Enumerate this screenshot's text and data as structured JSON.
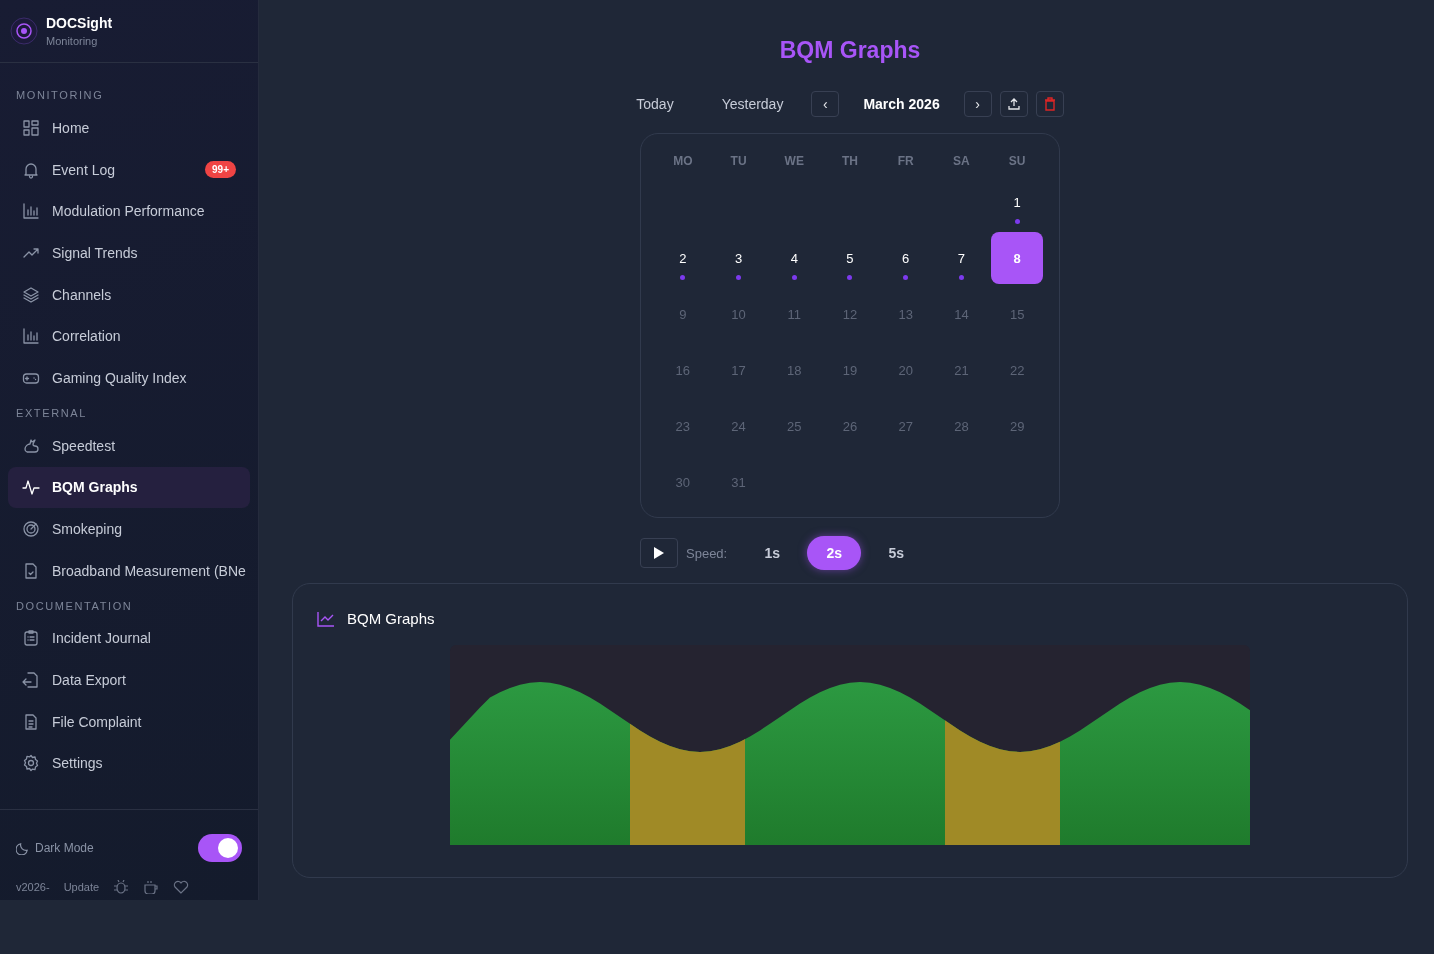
{
  "brand": {
    "name": "DOCSight",
    "subtitle": "Monitoring"
  },
  "sidebar": {
    "sections": [
      {
        "title": "MONITORING",
        "items": [
          {
            "label": "Home",
            "selected": false
          },
          {
            "label": "Event Log",
            "selected": false,
            "badge": "99+"
          },
          {
            "label": "Modulation Performance",
            "selected": false
          },
          {
            "label": "Signal Trends",
            "selected": false
          },
          {
            "label": "Channels",
            "selected": false
          },
          {
            "label": "Correlation",
            "selected": false
          },
          {
            "label": "Gaming Quality Index",
            "selected": false
          }
        ]
      },
      {
        "title": "EXTERNAL",
        "items": [
          {
            "label": "Speedtest",
            "selected": false
          },
          {
            "label": "BQM Graphs",
            "selected": true
          },
          {
            "label": "Smokeping",
            "selected": false
          },
          {
            "label": "Broadband Measurement (BNe",
            "selected": false
          }
        ]
      },
      {
        "title": "DOCUMENTATION",
        "items": [
          {
            "label": "Incident Journal",
            "selected": false
          },
          {
            "label": "Data Export",
            "selected": false
          },
          {
            "label": "File Complaint",
            "selected": false
          },
          {
            "label": "Settings",
            "selected": false
          }
        ]
      }
    ],
    "dark_mode": {
      "label": "Dark Mode",
      "on": true
    },
    "footer": {
      "version": "v2026-",
      "update": "Update"
    }
  },
  "page": {
    "title": "BQM Graphs",
    "quick_dates": [
      {
        "label": "Today"
      },
      {
        "label": "Yesterday"
      }
    ],
    "prev": "‹",
    "month": "March 2026",
    "next": "›",
    "weekdays": [
      "MO",
      "TU",
      "WE",
      "TH",
      "FR",
      "SA",
      "SU"
    ],
    "weeks": [
      [
        {
          "day": "1",
          "has_data": true,
          "selected": false
        }
      ],
      [
        {
          "day": "2",
          "has_data": true,
          "selected": false
        },
        {
          "day": "3",
          "has_data": true,
          "selected": false
        },
        {
          "day": "4",
          "has_data": true,
          "selected": false
        },
        {
          "day": "5",
          "has_data": true,
          "selected": false
        },
        {
          "day": "6",
          "has_data": true,
          "selected": false
        },
        {
          "day": "7",
          "has_data": true,
          "selected": false
        },
        {
          "day": "8",
          "has_data": true,
          "selected": true
        }
      ],
      [
        {
          "day": "9",
          "has_data": false,
          "selected": false
        },
        {
          "day": "10",
          "has_data": false,
          "selected": false
        },
        {
          "day": "11",
          "has_data": false,
          "selected": false
        },
        {
          "day": "12",
          "has_data": false,
          "selected": false
        },
        {
          "day": "13",
          "has_data": false,
          "selected": false
        },
        {
          "day": "14",
          "has_data": false,
          "selected": false
        },
        {
          "day": "15",
          "has_data": false,
          "selected": false
        }
      ],
      [
        {
          "day": "16",
          "has_data": false,
          "selected": false
        },
        {
          "day": "17",
          "has_data": false,
          "selected": false
        },
        {
          "day": "18",
          "has_data": false,
          "selected": false
        },
        {
          "day": "19",
          "has_data": false,
          "selected": false
        },
        {
          "day": "20",
          "has_data": false,
          "selected": false
        },
        {
          "day": "21",
          "has_data": false,
          "selected": false
        },
        {
          "day": "22",
          "has_data": false,
          "selected": false
        }
      ],
      [
        {
          "day": "23",
          "has_data": false,
          "selected": false
        },
        {
          "day": "24",
          "has_data": false,
          "selected": false
        },
        {
          "day": "25",
          "has_data": false,
          "selected": false
        },
        {
          "day": "26",
          "has_data": false,
          "selected": false
        },
        {
          "day": "27",
          "has_data": false,
          "selected": false
        },
        {
          "day": "28",
          "has_data": false,
          "selected": false
        },
        {
          "day": "29",
          "has_data": false,
          "selected": false
        }
      ],
      [
        {
          "day": "30",
          "has_data": false,
          "selected": false
        },
        {
          "day": "31",
          "has_data": false,
          "selected": false
        }
      ]
    ],
    "speed_label": "Speed:",
    "speeds": [
      {
        "label": "1s",
        "selected": false
      },
      {
        "label": "2s",
        "selected": true
      },
      {
        "label": "5s",
        "selected": false
      }
    ],
    "graph_card": {
      "title": "BQM Graphs"
    }
  }
}
